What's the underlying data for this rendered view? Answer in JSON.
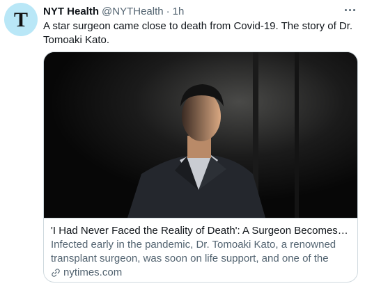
{
  "tweet": {
    "display_name": "NYT Health",
    "handle": "@NYTHealth",
    "separator": "·",
    "time": "1h",
    "text": "A star surgeon came close to death from Covid-19. The story of Dr. Tomoaki Kato.",
    "avatar_mark": "T"
  },
  "card": {
    "title": "'I Had Never Faced the Reality of Death': A Surgeon Becomes a Patient",
    "description": "Infected early in the pandemic, Dr. Tomoaki Kato, a renowned transplant surgeon, was soon on life support, and one of the sickest patients in hi...",
    "domain": "nytimes.com",
    "image_description": "portrait of a man in a dark suit against a dark background"
  },
  "icons": {
    "more": "more-options-icon",
    "link": "link-icon"
  },
  "colors": {
    "avatar_bg": "#b9e7f7",
    "secondary_text": "#536471",
    "border": "#cfd9de"
  }
}
